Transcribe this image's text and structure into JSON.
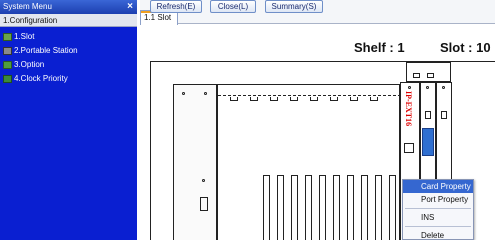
{
  "sidebar": {
    "title": "System Menu",
    "close_glyph": "×",
    "section": "1.Configuration",
    "items": [
      {
        "label": "1.Slot",
        "icon": "slot-icon"
      },
      {
        "label": "2.Portable Station",
        "icon": "portable-station-icon"
      },
      {
        "label": "3.Option",
        "icon": "option-icon"
      },
      {
        "label": "4.Clock Priority",
        "icon": "clock-priority-icon"
      }
    ]
  },
  "tabs": [
    {
      "label": "1.1 Slot"
    }
  ],
  "toolbar": {
    "refresh_label": "Refresh(E)",
    "close_label": "Close(L)",
    "summary_label": "Summary(S)",
    "shelf_text": "Shelf : 1",
    "slot_text": "Slot : 10"
  },
  "card": {
    "label": "IP-EXT16"
  },
  "context_menu": {
    "items": [
      "Card Property",
      "Port Property",
      "INS",
      "Delete"
    ]
  },
  "colors": {
    "sidebar_bg": "#0a1fd1",
    "menu_highlight": "#3567d0",
    "card_label": "#dd0000",
    "connector": "#2f6fd0"
  }
}
